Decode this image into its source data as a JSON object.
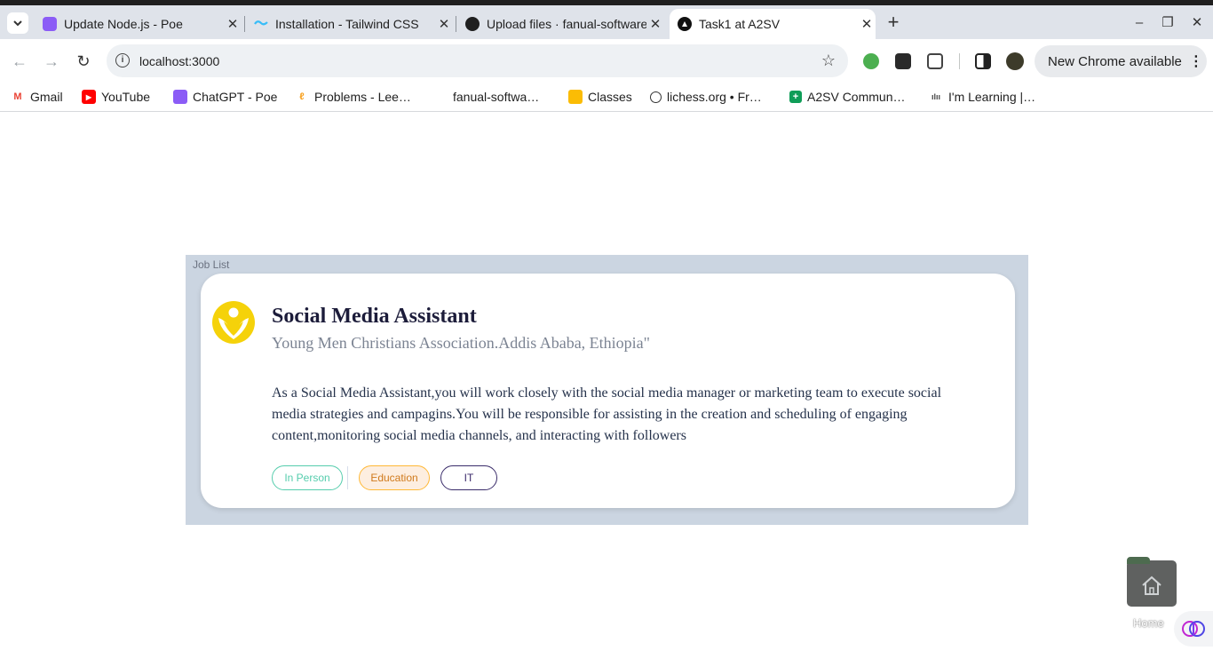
{
  "browser": {
    "tabs": [
      {
        "title": "Update Node.js - Poe",
        "icon": "poe-icon"
      },
      {
        "title": "Installation - Tailwind CSS",
        "icon": "tailwind-icon"
      },
      {
        "title": "Upload files · fanual-software",
        "icon": "github-icon"
      },
      {
        "title": "Task1 at A2SV",
        "icon": "nextjs-icon"
      }
    ],
    "url": "localhost:3000",
    "update_button": "New Chrome available",
    "bookmarks": [
      {
        "label": "Gmail",
        "icon": "gmail-icon"
      },
      {
        "label": "YouTube",
        "icon": "youtube-icon"
      },
      {
        "label": "ChatGPT - Poe",
        "icon": "poe-icon"
      },
      {
        "label": "Problems - Lee…",
        "icon": "leetcode-icon"
      },
      {
        "label": "fanual-softwa…",
        "icon": "github-icon"
      },
      {
        "label": "Classes",
        "icon": "classroom-icon"
      },
      {
        "label": "lichess.org • Fr…",
        "icon": "lichess-icon"
      },
      {
        "label": "A2SV Commun…",
        "icon": "sheets-icon"
      },
      {
        "label": "I'm Learning |…",
        "icon": "cisco-icon"
      }
    ]
  },
  "page": {
    "section_label": "Job List",
    "job": {
      "title": "Social Media Assistant",
      "company_location": "Young Men Christians Association.Addis Ababa, Ethiopia\"",
      "description": "As a Social Media Assistant,you will work closely with the social media manager or marketing team to execute social media strategies and campagins.You will be responsible for assisting in the creation and scheduling of engaging content,monitoring social media channels, and interacting with followers",
      "tags": [
        "In Person",
        "Education",
        "IT"
      ]
    },
    "home_label": "Home"
  },
  "colors": {
    "list_bg": "#cbd5e1",
    "tag_green": "#56cdad",
    "tag_orange": "#ffb836",
    "tag_purple": "#4640de"
  }
}
